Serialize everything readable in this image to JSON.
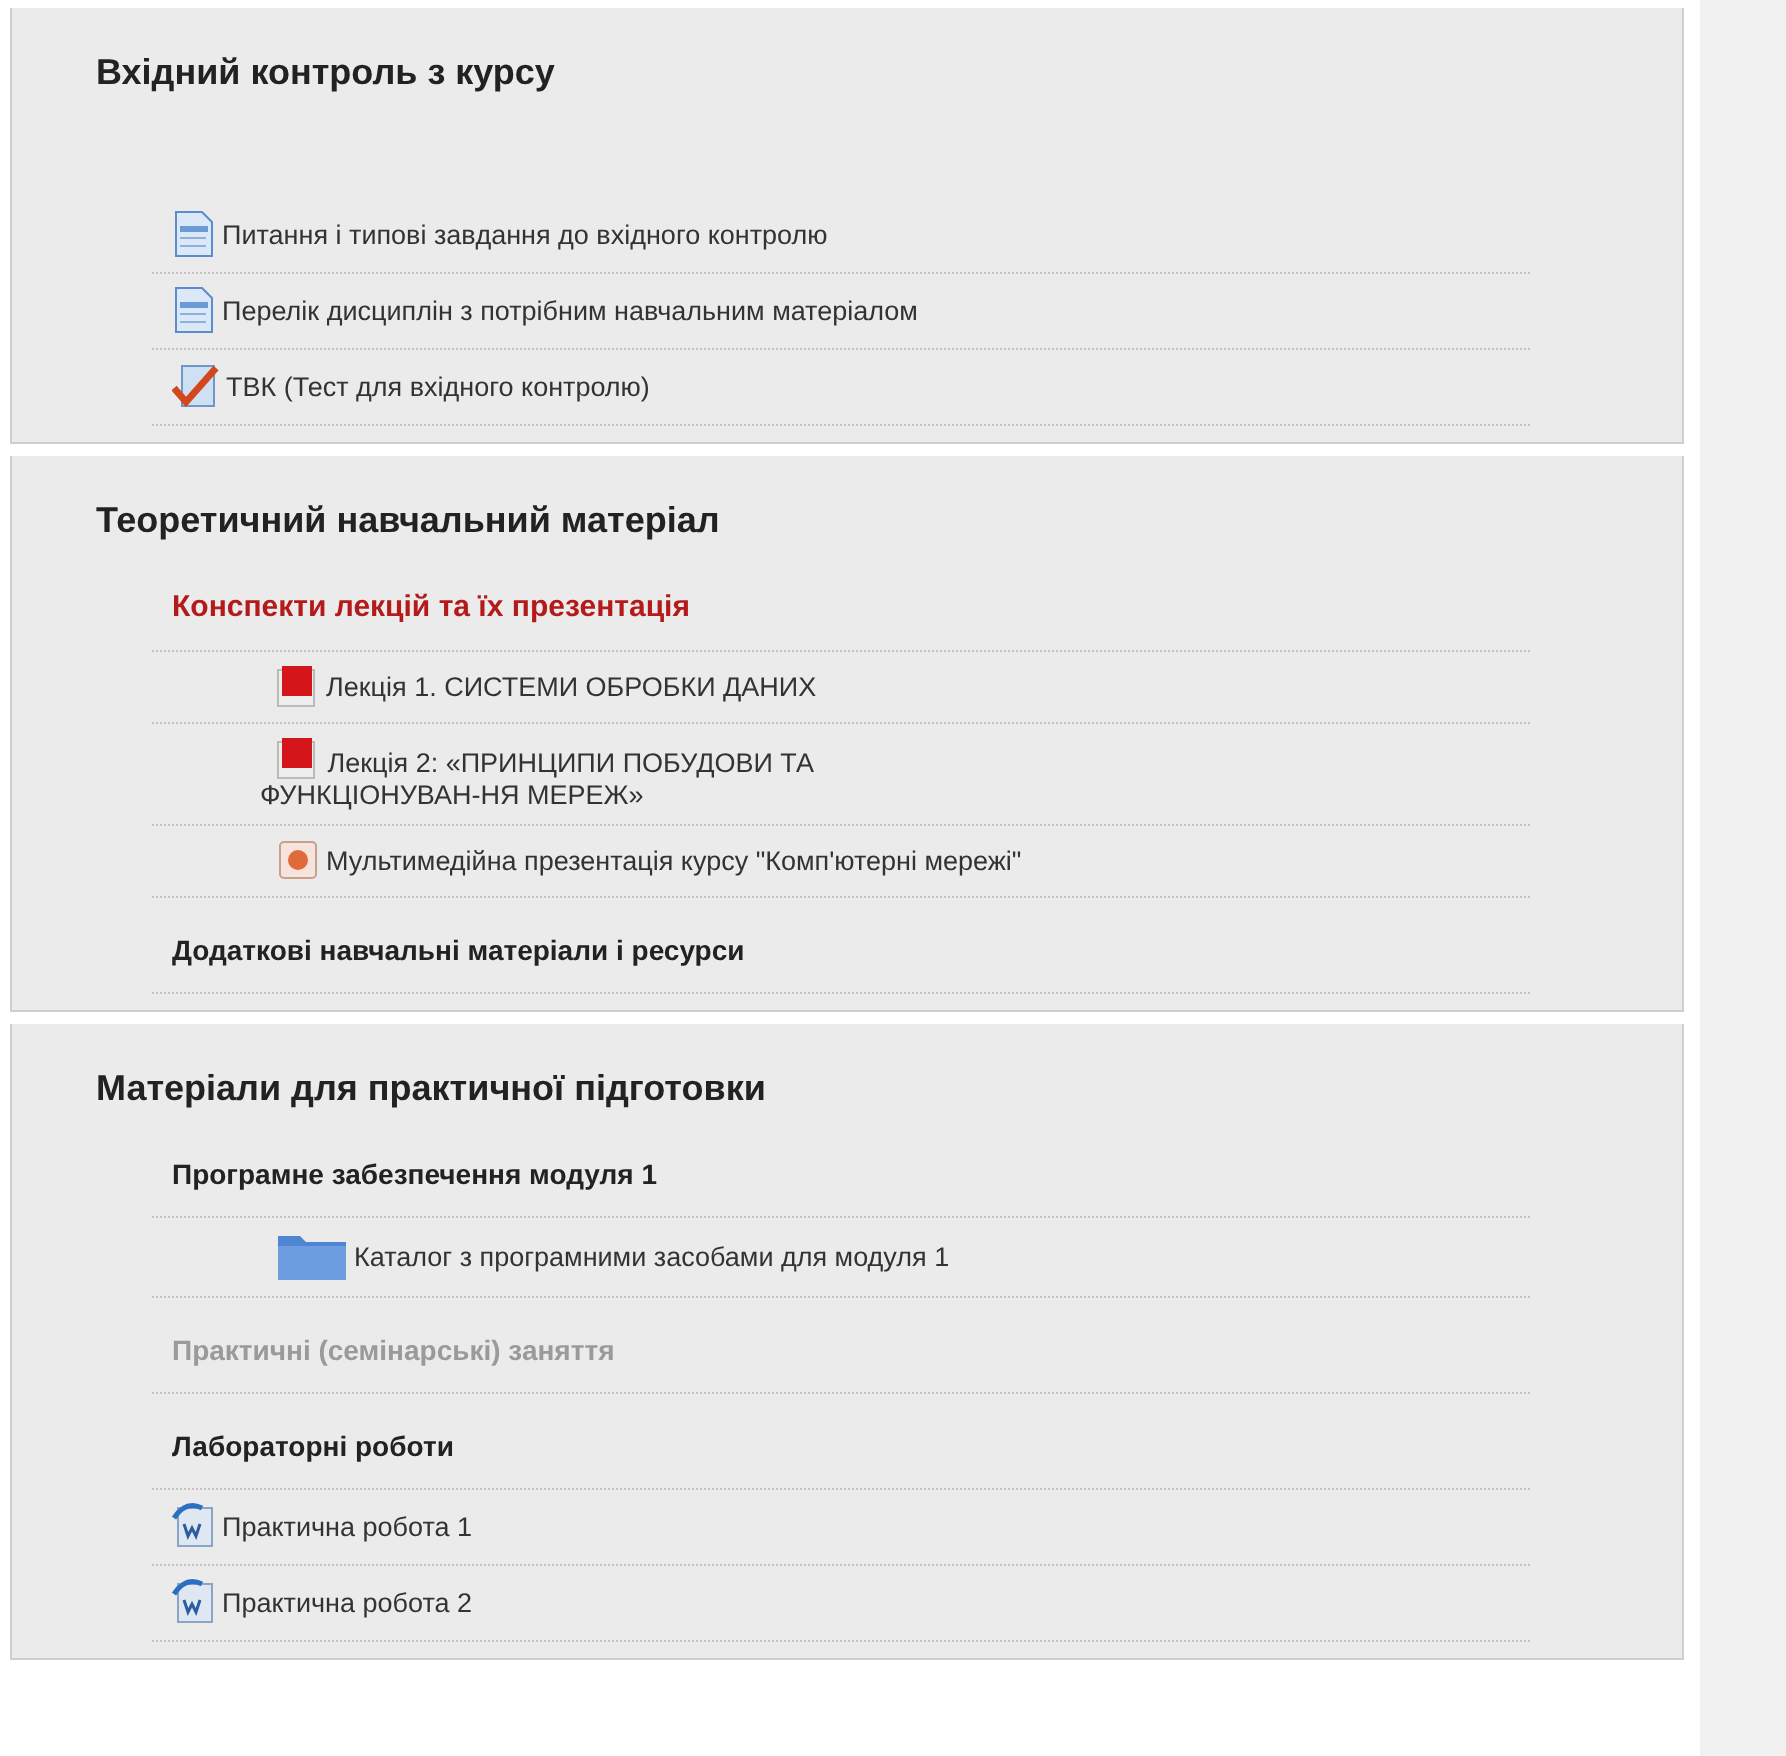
{
  "sections": [
    {
      "title": "Вхідний контроль з курсу",
      "items": [
        {
          "kind": "page",
          "text": "Питання і типові завдання до вхідного контролю"
        },
        {
          "kind": "page",
          "text": "Перелік дисциплін з потрібним навчальним матеріалом"
        },
        {
          "kind": "quiz",
          "text": "ТВК (Тест для вхідного контролю)"
        }
      ]
    },
    {
      "title": "Теоретичний навчальний матеріал",
      "items": [
        {
          "kind": "label",
          "text": "Конспекти лекцій та їх презентація",
          "color": "#b51a1a",
          "disabled": false,
          "children": [
            {
              "kind": "pdf",
              "text": "Лекція 1. СИСТЕМИ ОБРОБКИ ДАНИХ"
            },
            {
              "kind": "pdf",
              "text": "Лекція 2: «ПРИНЦИПИ ПОБУДОВИ ТА\nФУНКЦІОНУВАН-НЯ МЕРЕЖ»"
            },
            {
              "kind": "ppt",
              "text": "Мультимедійна презентація курсу \"Комп'ютерні мережі\""
            }
          ]
        },
        {
          "kind": "label",
          "text": "Додаткові навчальні матеріали і ресурси",
          "color": "#222222",
          "disabled": false
        }
      ]
    },
    {
      "title": "Матеріали для практичної підготовки",
      "items": [
        {
          "kind": "label",
          "text": "Програмне забезпечення модуля 1",
          "color": "#222222",
          "disabled": false,
          "children": [
            {
              "kind": "folder",
              "text": "Каталог з програмними засобами для модуля 1"
            }
          ]
        },
        {
          "kind": "label",
          "text": "Практичні (семінарські) заняття",
          "disabled": true
        },
        {
          "kind": "label",
          "text": "Лабораторні роботи",
          "color": "#222222",
          "disabled": false
        },
        {
          "kind": "doc",
          "text": "Практична робота 1"
        },
        {
          "kind": "doc",
          "text": "Практична робота 2"
        }
      ]
    }
  ]
}
